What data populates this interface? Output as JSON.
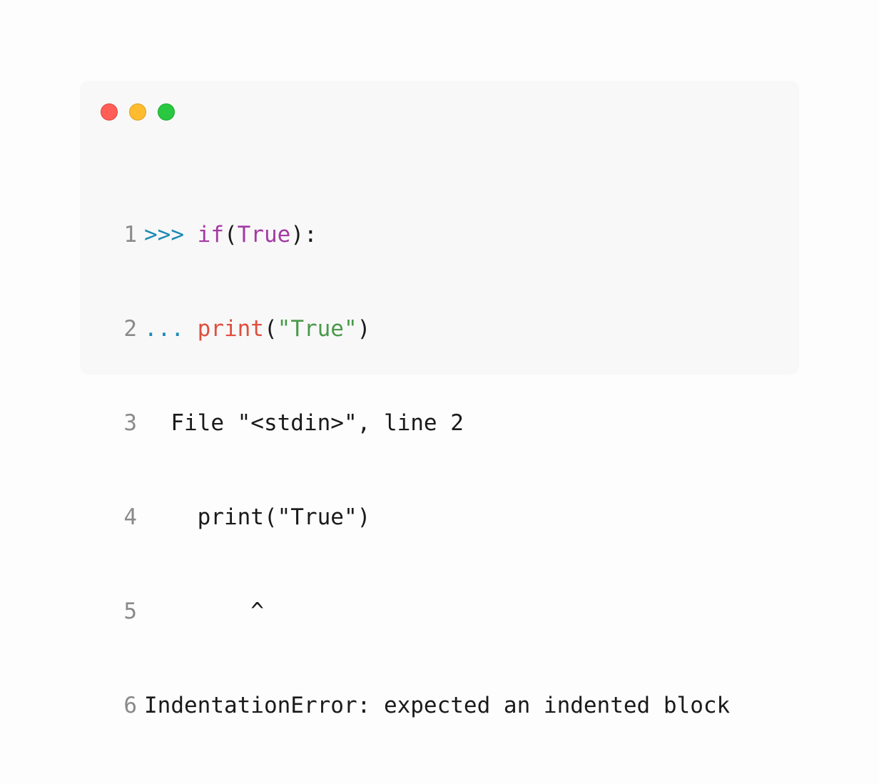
{
  "window": {
    "controls": [
      "close",
      "minimize",
      "zoom"
    ],
    "colors": {
      "close": "#ff5f57",
      "minimize": "#febc2e",
      "zoom": "#28c840",
      "background": "#f8f8f8"
    }
  },
  "code": {
    "lines": [
      {
        "number": "1",
        "tokens": [
          {
            "text": ">>> ",
            "kind": "prompt"
          },
          {
            "text": "if",
            "kind": "keyword"
          },
          {
            "text": "(",
            "kind": "plain"
          },
          {
            "text": "True",
            "kind": "keyword"
          },
          {
            "text": "):",
            "kind": "plain"
          }
        ]
      },
      {
        "number": "2",
        "tokens": [
          {
            "text": "... ",
            "kind": "prompt"
          },
          {
            "text": "print",
            "kind": "function"
          },
          {
            "text": "(",
            "kind": "plain"
          },
          {
            "text": "\"True\"",
            "kind": "string"
          },
          {
            "text": ")",
            "kind": "plain"
          }
        ]
      },
      {
        "number": "3",
        "tokens": [
          {
            "text": "  File \"<stdin>\", line 2",
            "kind": "plain"
          }
        ]
      },
      {
        "number": "4",
        "tokens": [
          {
            "text": "    print(\"True\")",
            "kind": "plain"
          }
        ]
      },
      {
        "number": "5",
        "tokens": [
          {
            "text": "        ^",
            "kind": "plain"
          }
        ]
      },
      {
        "number": "6",
        "tokens": [
          {
            "text": "IndentationError: expected an indented block",
            "kind": "plain"
          }
        ]
      }
    ]
  }
}
